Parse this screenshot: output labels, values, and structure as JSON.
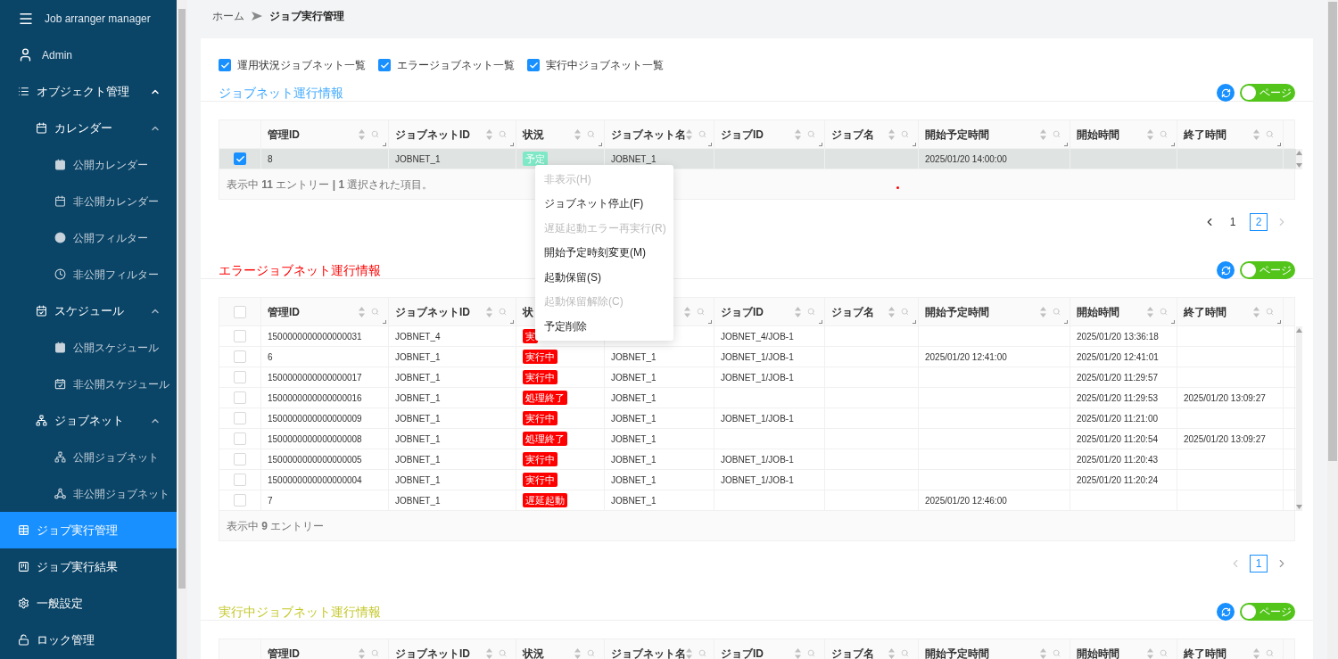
{
  "sidebar": {
    "title": "Job arranger manager",
    "user": "Admin",
    "items": [
      {
        "label": "オブジェクト管理",
        "selected": false,
        "expanded": true,
        "children": [
          {
            "label": "カレンダー",
            "selected": false,
            "expanded": true,
            "children": [
              {
                "label": "公開カレンダー",
                "selected": false
              },
              {
                "label": "非公開カレンダー",
                "selected": false
              },
              {
                "label": "公開フィルター",
                "selected": false
              },
              {
                "label": "非公開フィルター",
                "selected": false
              }
            ]
          },
          {
            "label": "スケジュール",
            "selected": false,
            "expanded": true,
            "children": [
              {
                "label": "公開スケジュール",
                "selected": false
              },
              {
                "label": "非公開スケジュール",
                "selected": false
              }
            ]
          },
          {
            "label": "ジョブネット",
            "selected": false,
            "expanded": true,
            "children": [
              {
                "label": "公開ジョブネット",
                "selected": false
              },
              {
                "label": "非公開ジョブネット",
                "selected": false
              }
            ]
          }
        ]
      },
      {
        "label": "ジョブ実行管理",
        "selected": true
      },
      {
        "label": "ジョブ実行結果",
        "selected": false
      },
      {
        "label": "一般設定",
        "selected": false
      },
      {
        "label": "ロック管理",
        "selected": false
      }
    ]
  },
  "breadcrumb": [
    "ホーム",
    "ジョブ実行管理"
  ],
  "filters": [
    {
      "label": "運用状況ジョブネット一覧",
      "checked": true
    },
    {
      "label": "エラージョブネット一覧",
      "checked": true
    },
    {
      "label": "実行中ジョブネット一覧",
      "checked": true
    }
  ],
  "sections": [
    {
      "title": "ジョブネット運行情報",
      "color": "#40a9ff",
      "toggle": {
        "label": "ページ",
        "on": true
      },
      "table": {
        "columns": [
          "管理ID",
          "ジョブネットID",
          "状況",
          "ジョブネット名",
          "ジョブID",
          "ジョブ名",
          "開始予定時間",
          "開始時間",
          "終了時間"
        ],
        "rows": [
          {
            "selected": true,
            "id": "8",
            "jobnet_id": "JOBNET_1",
            "status": {
              "text": "予定",
              "color": "#7fe8c6"
            },
            "jobnet_name": "JOBNET_1",
            "scheduled": "2025/01/20 14:00:00"
          }
        ],
        "footer": "表示中 **11** エントリー **|** **1** 選択された項目。"
      },
      "pagination": {
        "prev_disabled": false,
        "next_disabled": true,
        "pages": [
          {
            "label": "1",
            "selected": false
          },
          {
            "label": "2",
            "selected": true
          }
        ]
      }
    },
    {
      "title": "エラージョブネット運行情報",
      "color": "#ff0000",
      "toggle": {
        "label": "ページ",
        "on": true
      },
      "table": {
        "select_all": {
          "checked": false
        },
        "columns": [
          "管理ID",
          "ジョブネットID",
          "状",
          null,
          "ジョブID",
          "ジョブ名",
          "開始予定時間",
          "開始時間",
          "終了時間"
        ],
        "rows": [
          {
            "selected": false,
            "id": "1500000000000000031",
            "jobnet_id": "JOBNET_4",
            "status": {
              "text": "実",
              "color": "#ff0000"
            },
            "job_id": "JOBNET_4/JOB-1",
            "start": "2025/01/20 13:36:18"
          },
          {
            "selected": false,
            "id": "6",
            "jobnet_id": "JOBNET_1",
            "status": {
              "text": "実行中",
              "color": "#ff0000"
            },
            "jobnet_name": "JOBNET_1",
            "job_id": "JOBNET_1/JOB-1",
            "scheduled": "2025/01/20 12:41:00",
            "start": "2025/01/20 12:41:01"
          },
          {
            "selected": false,
            "id": "1500000000000000017",
            "jobnet_id": "JOBNET_1",
            "status": {
              "text": "実行中",
              "color": "#ff0000"
            },
            "jobnet_name": "JOBNET_1",
            "job_id": "JOBNET_1/JOB-1",
            "start": "2025/01/20 11:29:57"
          },
          {
            "selected": false,
            "id": "1500000000000000016",
            "jobnet_id": "JOBNET_1",
            "status": {
              "text": "処理終了",
              "color": "#ff0000"
            },
            "jobnet_name": "JOBNET_1",
            "start": "2025/01/20 11:29:53",
            "end": "2025/01/20 13:09:27"
          },
          {
            "selected": false,
            "id": "1500000000000000009",
            "jobnet_id": "JOBNET_1",
            "status": {
              "text": "実行中",
              "color": "#ff0000"
            },
            "jobnet_name": "JOBNET_1",
            "job_id": "JOBNET_1/JOB-1",
            "start": "2025/01/20 11:21:00"
          },
          {
            "selected": false,
            "id": "1500000000000000008",
            "jobnet_id": "JOBNET_1",
            "status": {
              "text": "処理終了",
              "color": "#ff0000"
            },
            "jobnet_name": "JOBNET_1",
            "start": "2025/01/20 11:20:54",
            "end": "2025/01/20 13:09:27"
          },
          {
            "selected": false,
            "id": "1500000000000000005",
            "jobnet_id": "JOBNET_1",
            "status": {
              "text": "実行中",
              "color": "#ff0000"
            },
            "jobnet_name": "JOBNET_1",
            "job_id": "JOBNET_1/JOB-1",
            "start": "2025/01/20 11:20:43"
          },
          {
            "selected": false,
            "id": "1500000000000000004",
            "jobnet_id": "JOBNET_1",
            "status": {
              "text": "実行中",
              "color": "#ff0000"
            },
            "jobnet_name": "JOBNET_1",
            "job_id": "JOBNET_1/JOB-1",
            "start": "2025/01/20 11:20:24"
          },
          {
            "selected": false,
            "id": "7",
            "jobnet_id": "JOBNET_1",
            "status": {
              "text": "遅延起動",
              "color": "#ff0000"
            },
            "jobnet_name": "JOBNET_1",
            "scheduled": "2025/01/20 12:46:00"
          }
        ],
        "footer": "表示中 **9** エントリー"
      },
      "pagination": {
        "prev_disabled": true,
        "next_disabled": false,
        "pages": [
          {
            "label": "1",
            "selected": true
          }
        ]
      }
    },
    {
      "title": "実行中ジョブネット運行情報",
      "color": "#c4c82a",
      "toggle": {
        "label": "ページ",
        "on": true
      },
      "table": {
        "columns": [
          "管理ID",
          "ジョブネットID",
          "状況",
          "ジョブネット名",
          "ジョブID",
          "ジョブ名",
          "開始予定時間",
          "開始時間",
          "終了時間"
        ]
      }
    }
  ],
  "context_menu": {
    "items": [
      {
        "label": "非表示(H)",
        "disabled": true
      },
      {
        "label": "ジョブネット停止(F)",
        "disabled": false
      },
      {
        "label": "遅延起動エラー再実行(R)",
        "disabled": true
      },
      {
        "label": "開始予定時刻変更(M)",
        "disabled": false
      },
      {
        "label": "起動保留(S)",
        "disabled": false
      },
      {
        "label": "起動保留解除(C)",
        "disabled": true
      },
      {
        "label": "予定削除",
        "disabled": false
      }
    ]
  }
}
